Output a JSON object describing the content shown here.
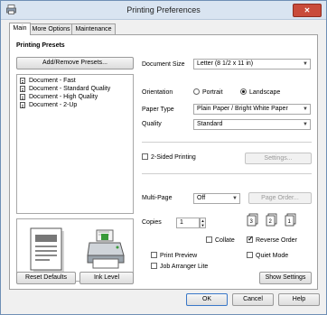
{
  "window": {
    "title": "Printing Preferences",
    "close_label": "✕"
  },
  "tabs": [
    {
      "label": "Main"
    },
    {
      "label": "More Options"
    },
    {
      "label": "Maintenance"
    }
  ],
  "presets": {
    "heading": "Printing Presets",
    "add_remove_label": "Add/Remove Presets...",
    "items": [
      {
        "label": "Document - Fast"
      },
      {
        "label": "Document - Standard Quality"
      },
      {
        "label": "Document - High Quality"
      },
      {
        "label": "Document - 2-Up"
      }
    ]
  },
  "settings": {
    "document_size_label": "Document Size",
    "document_size_value": "Letter (8 1/2 x 11 in)",
    "orientation_label": "Orientation",
    "portrait_label": "Portrait",
    "landscape_label": "Landscape",
    "orientation_selected": "Landscape",
    "paper_type_label": "Paper Type",
    "paper_type_value": "Plain Paper / Bright White Paper",
    "quality_label": "Quality",
    "quality_value": "Standard",
    "two_sided_label": "2-Sided Printing",
    "two_sided_checked": false,
    "settings_button": "Settings...",
    "multi_page_label": "Multi-Page",
    "multi_page_value": "Off",
    "page_order_button": "Page Order...",
    "copies_label": "Copies",
    "copies_value": "1",
    "collate_label": "Collate",
    "collate_checked": false,
    "reverse_order_label": "Reverse Order",
    "reverse_order_checked": true,
    "print_preview_label": "Print Preview",
    "print_preview_checked": false,
    "job_arranger_label": "Job Arranger Lite",
    "job_arranger_checked": false,
    "quiet_mode_label": "Quiet Mode",
    "quiet_mode_checked": false,
    "show_settings_button": "Show Settings",
    "reset_defaults_button": "Reset Defaults",
    "ink_level_button": "Ink Level"
  },
  "footer": {
    "ok_label": "OK",
    "cancel_label": "Cancel",
    "help_label": "Help"
  }
}
